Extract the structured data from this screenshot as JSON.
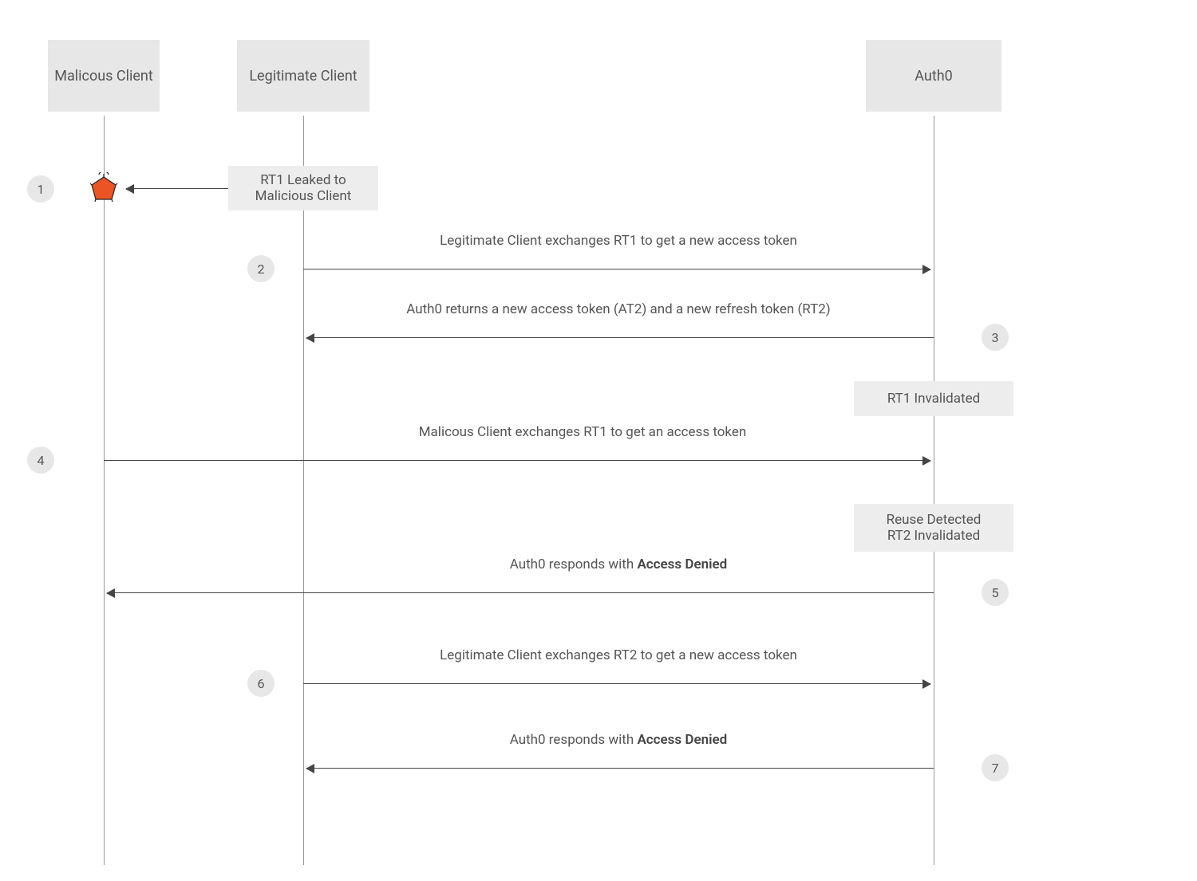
{
  "actors": {
    "malicious": "Malicous Client",
    "legitimate": "Legitimate Client",
    "auth0": "Auth0"
  },
  "steps": {
    "s1": "1",
    "s2": "2",
    "s3": "3",
    "s4": "4",
    "s5": "5",
    "s6": "6",
    "s7": "7"
  },
  "notes": {
    "leaked": "RT1 Leaked to Malicious Client",
    "invalidated1": "RT1 Invalidated",
    "reuse_line1": "Reuse Detected",
    "reuse_line2": "RT2 Invalidated"
  },
  "messages": {
    "m2": "Legitimate Client exchanges RT1 to get a new access token",
    "m3": "Auth0 returns a new access token (AT2) and a new refresh token (RT2)",
    "m4": "Malicous Client exchanges RT1 to get an access token",
    "m5_pre": "Auth0 responds with ",
    "m5_bold": "Access Denied",
    "m6": "Legitimate Client exchanges RT2 to get a new access token",
    "m7_pre": "Auth0 responds with ",
    "m7_bold": "Access Denied"
  },
  "icons": {
    "hacker": "hacker-icon"
  },
  "colors": {
    "box_bg": "#e7e7e7",
    "accent": "#eb5424"
  }
}
